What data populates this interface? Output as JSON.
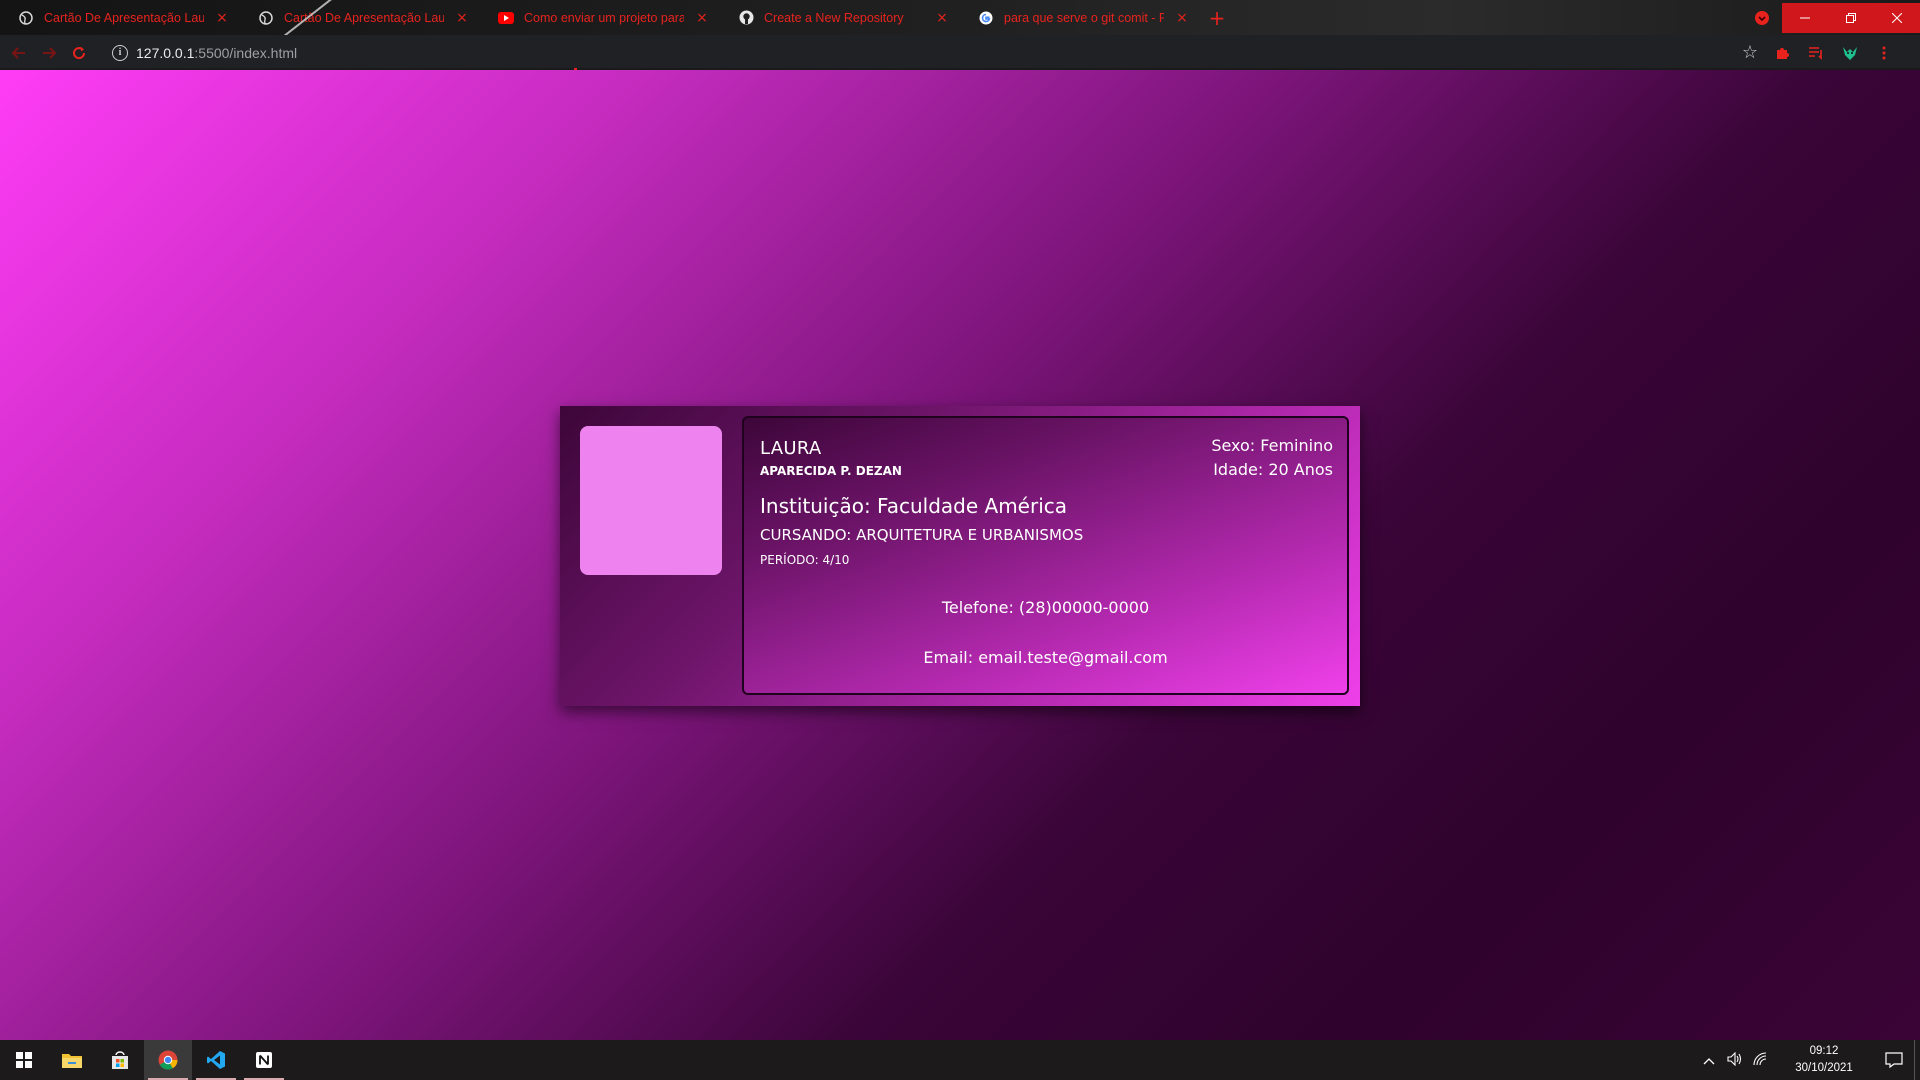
{
  "browser": {
    "tabs": [
      {
        "title": "Cartão De Apresentação Laura D",
        "icon": "globe-icon"
      },
      {
        "title": "Cartão De Apresentação Laura D",
        "icon": "globe-icon"
      },
      {
        "title": "Como enviar um projeto para o G",
        "icon": "youtube-icon"
      },
      {
        "title": "Create a New Repository",
        "icon": "github-icon"
      },
      {
        "title": "para que serve o git comit - Pesq",
        "icon": "google-icon"
      }
    ],
    "tab_close": "×",
    "new_tab": "+",
    "url_host": "127.0.0.1",
    "url_rest": ":5500/index.html",
    "accent_color": "#e8231e"
  },
  "card": {
    "first_name": "LAURA",
    "last_name": "APARECIDA P. DEZAN",
    "gender": "Sexo: Feminino",
    "age": "Idade: 20 Anos",
    "institution": "Instituição: Faculdade América",
    "course": "CURSANDO: ARQUITETURA E URBANISMOS",
    "period": "PERÍODO: 4/10",
    "phone": "Telefone: (28)00000-0000",
    "email": "Email: email.teste@gmail.com",
    "photo_color": "#ee82ee"
  },
  "taskbar": {
    "apps": [
      "windows-start-icon",
      "file-explorer-icon",
      "store-icon",
      "chrome-icon",
      "vscode-icon",
      "notion-icon"
    ],
    "time": "09:12",
    "date": "30/10/2021"
  }
}
